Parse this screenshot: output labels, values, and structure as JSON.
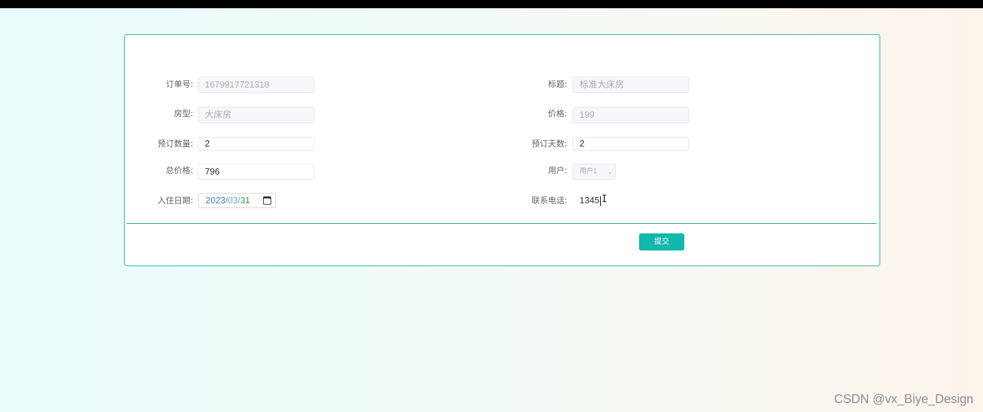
{
  "form": {
    "order_no": {
      "label": "订单号:",
      "value": "1679917721318"
    },
    "title": {
      "label": "标题:",
      "value": "标准大床房"
    },
    "room_type": {
      "label": "房型:",
      "value": "大床房"
    },
    "price": {
      "label": "价格:",
      "value": "199"
    },
    "booking_qty": {
      "label": "预订数量:",
      "value": "2"
    },
    "booking_days": {
      "label": "预订天数:",
      "value": "2"
    },
    "total_price": {
      "label": "总价格:",
      "value": "796"
    },
    "user": {
      "label": "用户:",
      "value": "用户1"
    },
    "checkin_date": {
      "label": "入住日期:",
      "year": "2023",
      "month": "03",
      "day": "31",
      "sep": "/"
    },
    "phone": {
      "label": "联系电话:",
      "value": "1345"
    },
    "submit_label": "提交"
  },
  "watermark": "CSDN @vx_Biye_Design",
  "icons": {
    "calendar": "calendar-icon",
    "chevron": "chevron-down-icon",
    "cursor": "text-cursor-icon"
  }
}
